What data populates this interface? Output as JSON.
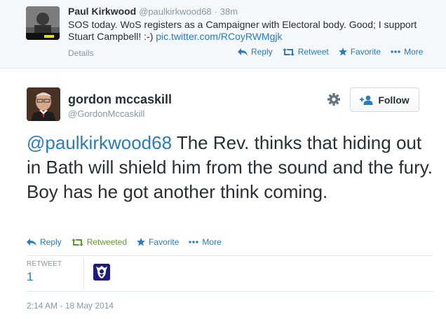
{
  "parent_tweet": {
    "author_name": "Paul Kirkwood",
    "author_handle": "@paulkirkwood68",
    "separator": "·",
    "time": "38m",
    "text": "SOS today. WoS registers as a Campaigner with Electoral body. Good;  I support Stuart Campbell! :-) ",
    "link": "pic.twitter.com/RCoyRWMgjk",
    "avatar_caption": "Paul Kirkwood avatar",
    "details_label": "Details",
    "actions": {
      "reply": "Reply",
      "retweet": "Retweet",
      "favorite": "Favorite",
      "more": "More"
    }
  },
  "tweet": {
    "author_name": "gordon mccaskill",
    "author_handle": "@GordonMccaskill",
    "follow_label": "Follow",
    "mention": "@paulkirkwood68",
    "text": " The Rev. thinks that hiding out in Bath will shield him from the sound and the fury. Boy has he got another think coming.",
    "actions": {
      "reply": "Reply",
      "retweeted": "Retweeted",
      "favorite": "Favorite",
      "more": "More"
    },
    "stats": {
      "retweet_label": "RETWEET",
      "retweet_count": "1"
    },
    "timestamp": "2:14 AM - 18 May 2014"
  },
  "colors": {
    "link": "#2b7bb9",
    "retweeted": "#609928",
    "muted": "#8899a6",
    "text": "#292f33",
    "parent_bg": "#f5f8fa"
  },
  "icons": {
    "reply": "reply-arrow-icon",
    "retweet": "retweet-icon",
    "favorite": "star-icon",
    "more": "ellipsis-icon",
    "settings": "gear-icon",
    "follow": "add-user-icon"
  }
}
